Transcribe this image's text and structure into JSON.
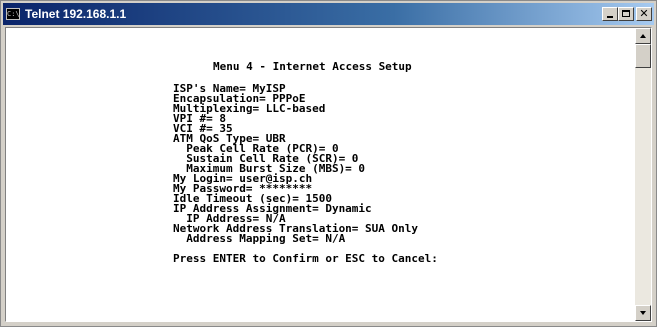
{
  "window": {
    "title": "Telnet 192.168.1.1",
    "icon_name": "console-icon",
    "icon_glyph": "C:\\"
  },
  "terminal": {
    "lines": [
      "Menu 4 - Internet Access Setup",
      "ISP's Name= MyISP",
      "Encapsulation= PPPoE",
      "Multiplexing= LLC-based",
      "VPI #= 8",
      "VCI #= 35",
      "ATM QoS Type= UBR",
      "  Peak Cell Rate (PCR)= 0",
      "  Sustain Cell Rate (SCR)= 0",
      "  Maximum Burst Size (MBS)= 0",
      "My Login= user@isp.ch",
      "My Password= ********",
      "Idle Timeout (sec)= 1500",
      "IP Address Assignment= Dynamic",
      "  IP Address= N/A",
      "Network Address Translation= SUA Only",
      "  Address Mapping Set= N/A",
      "Press ENTER to Confirm or ESC to Cancel:"
    ]
  },
  "colors": {
    "terminal_bg": "#ffffff",
    "terminal_fg": "#000000",
    "titlebar_start": "#0a246a",
    "titlebar_end": "#a6caf0"
  }
}
